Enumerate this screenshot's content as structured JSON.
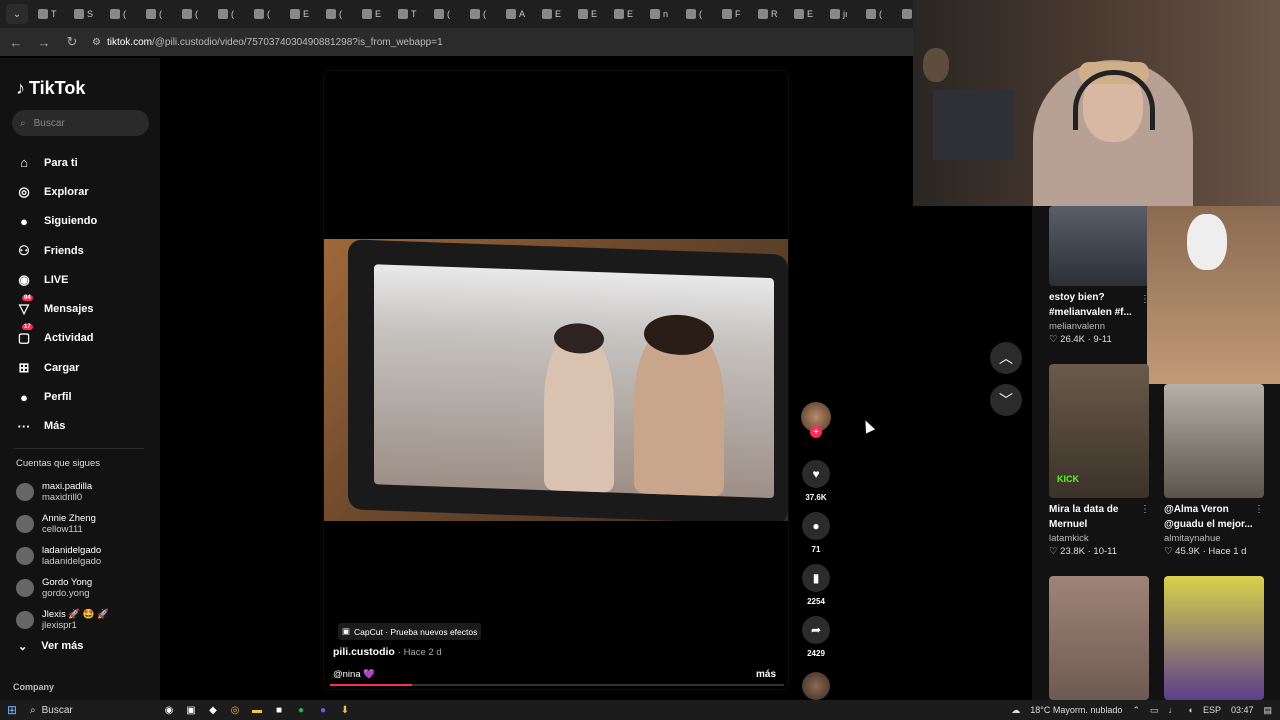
{
  "browser": {
    "tabs": [
      "T",
      "S",
      "(",
      "(",
      "(",
      "(",
      "(",
      "E",
      "(",
      "E",
      "T",
      "(",
      "(",
      "A",
      "E",
      "E",
      "E",
      "n",
      "(",
      "F",
      "R",
      "E",
      "jı",
      "(",
      "h",
      "(",
      "("
    ],
    "url_domain": "tiktok.com",
    "url_path": "/@pili.custodio/video/7570374030490881298?is_from_webapp=1"
  },
  "sidebar": {
    "logo_text": "TikTok",
    "search_placeholder": "Buscar",
    "nav": [
      {
        "label": "Para ti",
        "icon": "home-icon"
      },
      {
        "label": "Explorar",
        "icon": "compass-icon"
      },
      {
        "label": "Siguiendo",
        "icon": "following-avatar"
      },
      {
        "label": "Friends",
        "icon": "friends-icon"
      },
      {
        "label": "LIVE",
        "icon": "live-icon"
      },
      {
        "label": "Mensajes",
        "icon": "messages-icon",
        "badge": "94"
      },
      {
        "label": "Actividad",
        "icon": "activity-icon",
        "badge": "17"
      },
      {
        "label": "Cargar",
        "icon": "upload-icon"
      },
      {
        "label": "Perfil",
        "icon": "profile-icon"
      },
      {
        "label": "Más",
        "icon": "more-icon"
      }
    ],
    "following_title": "Cuentas que sigues",
    "following": [
      {
        "name": "maxi.padilla",
        "handle": "maxidrill0"
      },
      {
        "name": "Annie Zheng",
        "handle": "cellow111"
      },
      {
        "name": "ladanidelgado",
        "handle": "ladanidelgado"
      },
      {
        "name": "Gordo Yong",
        "handle": "gordo.yong"
      },
      {
        "name": "Jlexis 🚀 🤩 🚀",
        "handle": "jlexispr1"
      }
    ],
    "see_more": "Ver más",
    "company": "Company"
  },
  "video": {
    "tag": "CapCut · Prueba nuevos efectos",
    "author": "pili.custodio",
    "time": "· Hace 2 d",
    "caption": "@nina 💜",
    "more": "más",
    "progress": 0.18
  },
  "actions": {
    "likes": "37.6K",
    "comments": "71",
    "saves": "2254",
    "shares": "2429"
  },
  "feed": [
    {
      "title": "estoy bien? #melianvalen #f...",
      "user": "melianvalenn",
      "meta": "♡ 26.4K · 9-11"
    },
    {
      "title": "Mira la data de Mernuel",
      "user": "latamkick",
      "meta": "♡ 23.8K · 10-11"
    },
    {
      "title": "@Alma Veron @guadu el mejor...",
      "user": "almitaynahue",
      "meta": "♡ 45.9K · Hace 1 d"
    }
  ],
  "taskbar": {
    "search": "Buscar",
    "weather": "18°C  Mayorm. nublado",
    "lang": "ESP",
    "time": "03:47"
  },
  "colors": {
    "accent": "#fe2c55",
    "background": "#000000",
    "sidebar": "#121212"
  }
}
